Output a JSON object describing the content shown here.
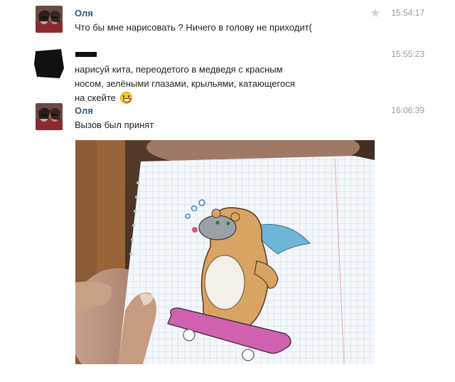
{
  "messages": [
    {
      "author": "Оля",
      "time": "15:54:17",
      "text": "Что бы мне нарисовать ? Ничего в голову не приходит(",
      "starred": true
    },
    {
      "author": "",
      "time": "15:55:23",
      "text": "нарисуй кита, переодетого в медведя с красным носом, зелёными глазами, крыльями, катающегося на скейте"
    },
    {
      "author": "Оля",
      "time": "16:06:39",
      "text": "Вызов был принят",
      "attachment": "photo"
    }
  ],
  "icons": {
    "star": "star-icon",
    "emoji": "laughing-emoji-icon"
  },
  "colors": {
    "author_link": "#2b587a",
    "timestamp": "#999999",
    "message_text": "#222222",
    "skateboard": "#d060b0",
    "wings": "#6fb5d8"
  }
}
